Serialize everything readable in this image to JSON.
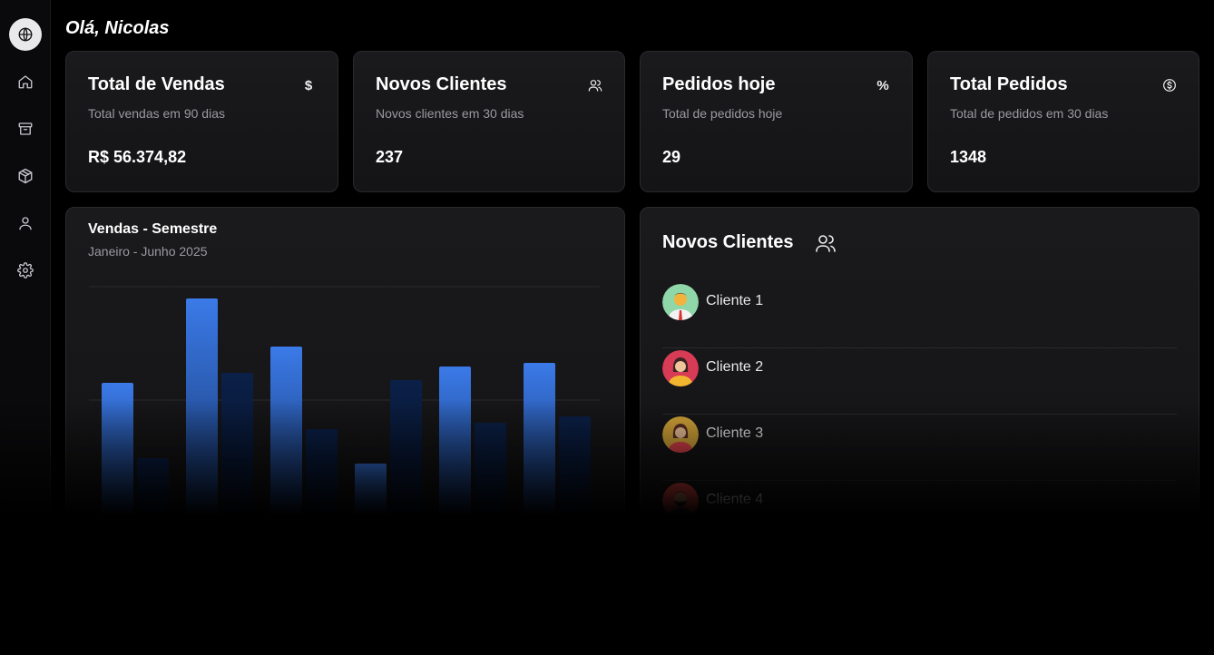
{
  "greeting": "Olá, Nicolas",
  "sidebar": {
    "items": [
      {
        "icon": "globe-icon",
        "active": true
      },
      {
        "icon": "home-icon"
      },
      {
        "icon": "archive-icon"
      },
      {
        "icon": "package-icon"
      },
      {
        "icon": "user-icon"
      },
      {
        "icon": "settings-icon"
      }
    ]
  },
  "stats": [
    {
      "title": "Total de Vendas",
      "subtitle": "Total vendas em 90 dias",
      "value": "R$ 56.374,82",
      "icon": "dollar-icon",
      "glyph": "$"
    },
    {
      "title": "Novos Clientes",
      "subtitle": "Novos clientes em 30 dias",
      "value": "237",
      "icon": "users-icon"
    },
    {
      "title": "Pedidos hoje",
      "subtitle": "Total de pedidos hoje",
      "value": "29",
      "icon": "percent-icon",
      "glyph": "%"
    },
    {
      "title": "Total Pedidos",
      "subtitle": "Total de pedidos em 30 dias",
      "value": "1348",
      "icon": "dollar-circle-icon"
    }
  ],
  "sales_chart": {
    "title": "Vendas - Semestre",
    "subtitle": "Janeiro - Junho 2025"
  },
  "chart_data": {
    "type": "bar",
    "title": "Vendas - Semestre",
    "subtitle": "Janeiro - Junho 2025",
    "categories": [
      "",
      "",
      "",
      "",
      "",
      ""
    ],
    "series": [
      {
        "values": [
          145,
          238,
          185,
          56,
          163,
          167
        ]
      },
      {
        "values": [
          62,
          156,
          94,
          148,
          101,
          108
        ]
      }
    ],
    "ylim": [
      0,
      250
    ],
    "grid": true,
    "colors": [
      "#3b7ae8",
      "#0a1c3e"
    ]
  },
  "clients_panel": {
    "title": "Novos Clientes",
    "icon": "users-icon",
    "clients": [
      {
        "name": "Cliente 1",
        "avatar": "male-avatar"
      },
      {
        "name": "Cliente 2",
        "avatar": "female-avatar"
      },
      {
        "name": "Cliente 3",
        "avatar": "female-avatar"
      },
      {
        "name": "Cliente 4",
        "avatar": "male-bearded-avatar"
      }
    ]
  }
}
